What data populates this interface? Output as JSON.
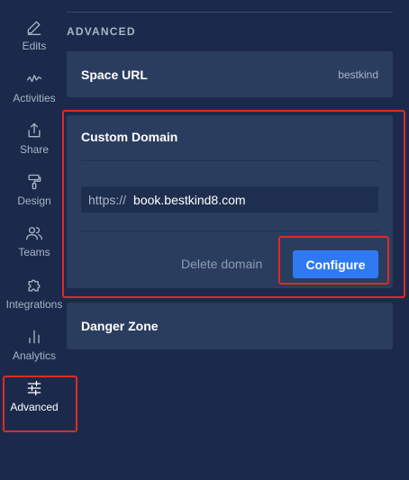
{
  "sidebar": {
    "items": [
      {
        "label": "Edits",
        "icon": "pencil-icon"
      },
      {
        "label": "Activities",
        "icon": "activity-icon"
      },
      {
        "label": "Share",
        "icon": "share-icon"
      },
      {
        "label": "Design",
        "icon": "paint-roller-icon"
      },
      {
        "label": "Teams",
        "icon": "users-icon"
      },
      {
        "label": "Integrations",
        "icon": "puzzle-icon"
      },
      {
        "label": "Analytics",
        "icon": "bar-chart-icon"
      },
      {
        "label": "Advanced",
        "icon": "sliders-icon"
      }
    ],
    "active": "Advanced"
  },
  "main": {
    "section_title": "ADVANCED",
    "space_url": {
      "title": "Space URL",
      "value": "bestkind"
    },
    "custom_domain": {
      "title": "Custom Domain",
      "prefix": "https://",
      "domain": "book.bestkind8.com",
      "delete_label": "Delete domain",
      "configure_label": "Configure"
    },
    "danger_zone": {
      "title": "Danger Zone"
    }
  },
  "colors": {
    "background": "#1b2a4a",
    "card": "#2b3d5f",
    "accent": "#2f7af3",
    "highlight": "#e02a24"
  }
}
